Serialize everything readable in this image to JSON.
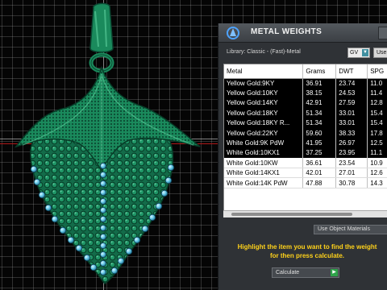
{
  "panel": {
    "title": "METAL WEIGHTS",
    "library_label": "Library: Classic - (Fast)-Metal",
    "unit_select": "GV",
    "user_button": "User",
    "columns": [
      "Metal",
      "Grams",
      "DWT",
      "SPG"
    ],
    "rows": [
      {
        "metal": "Yellow Gold:9KY",
        "grams": "36.91",
        "dwt": "23.74",
        "spg": "11.0"
      },
      {
        "metal": "Yellow Gold:10KY",
        "grams": "38.15",
        "dwt": "24.53",
        "spg": "11.4"
      },
      {
        "metal": "Yellow Gold:14KY",
        "grams": "42.91",
        "dwt": "27.59",
        "spg": "12.8"
      },
      {
        "metal": "Yellow Gold:18KY",
        "grams": "51.34",
        "dwt": "33.01",
        "spg": "15.4"
      },
      {
        "metal": "Yellow Gold:18KY R...",
        "grams": "51.34",
        "dwt": "33.01",
        "spg": "15.4"
      },
      {
        "metal": "Yellow Gold:22KY",
        "grams": "59.60",
        "dwt": "38.33",
        "spg": "17.8"
      },
      {
        "metal": "White Gold:9K PdW",
        "grams": "41.95",
        "dwt": "26.97",
        "spg": "12.5"
      },
      {
        "metal": "White Gold:10KX1",
        "grams": "37.25",
        "dwt": "23.95",
        "spg": "11.1"
      },
      {
        "metal": "White Gold:10KW",
        "grams": "36.61",
        "dwt": "23.54",
        "spg": "10.9"
      },
      {
        "metal": "White Gold:14KX1",
        "grams": "42.01",
        "dwt": "27.01",
        "spg": "12.6"
      },
      {
        "metal": "White Gold:14K PdW",
        "grams": "47.88",
        "dwt": "30.78",
        "spg": "14.3"
      }
    ],
    "use_object_button": "Use Object Materials",
    "instruction_line1": "Highlight the item you want to find the weight",
    "instruction_line2": "for then press calculate.",
    "calculate_select": "Calculate"
  },
  "colors": {
    "model": "#157a55",
    "model_dark": "#0b4a33",
    "gem": "#67c8e6",
    "instruction": "#ffd21a",
    "selected_row_bg": "#000000"
  }
}
